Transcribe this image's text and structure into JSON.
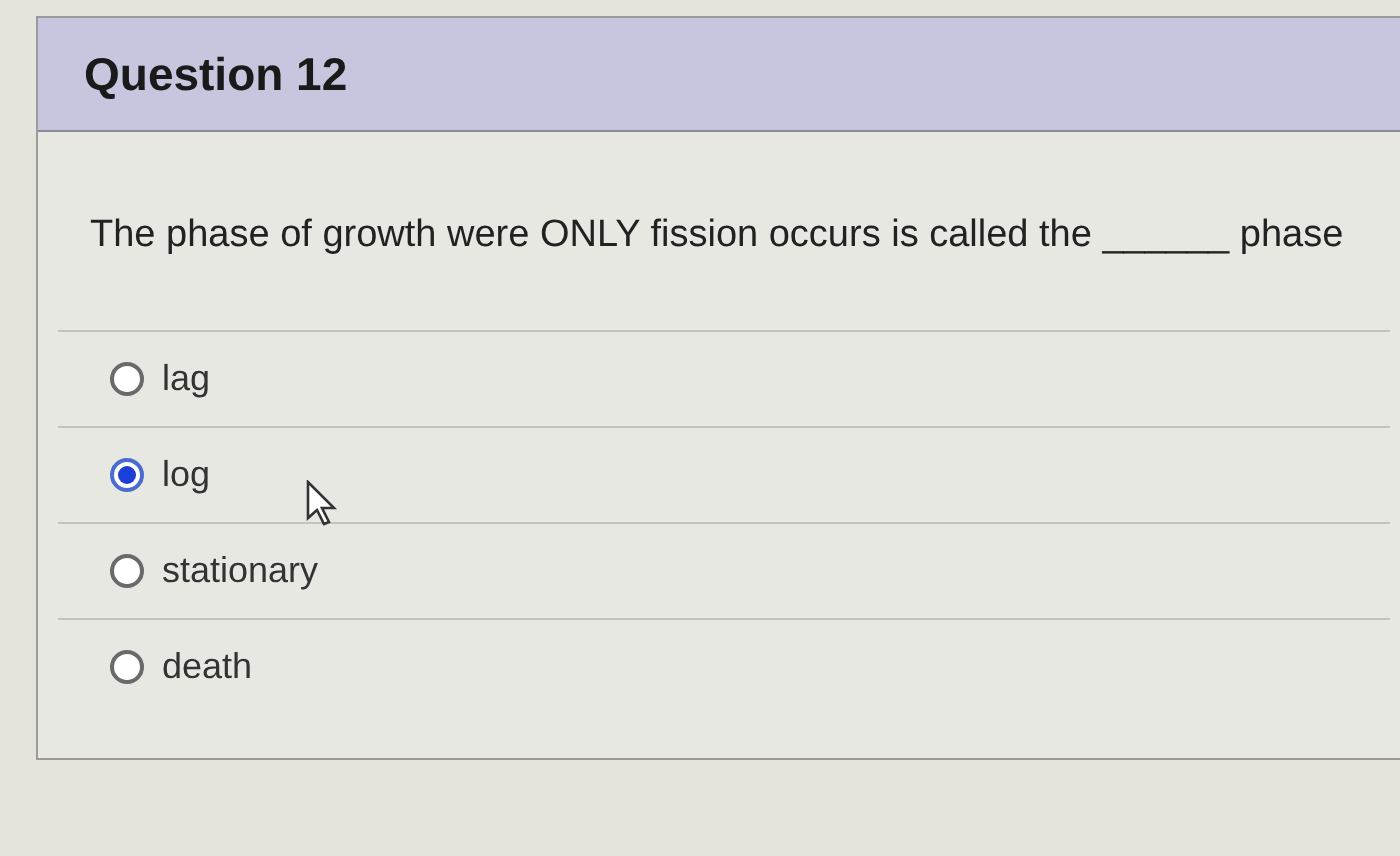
{
  "question": {
    "title": "Question 12",
    "text": "The phase of growth were ONLY fission occurs is called the ______ phase",
    "options": [
      {
        "label": "lag",
        "selected": false
      },
      {
        "label": "log",
        "selected": true
      },
      {
        "label": "stationary",
        "selected": false
      },
      {
        "label": "death",
        "selected": false
      }
    ]
  }
}
